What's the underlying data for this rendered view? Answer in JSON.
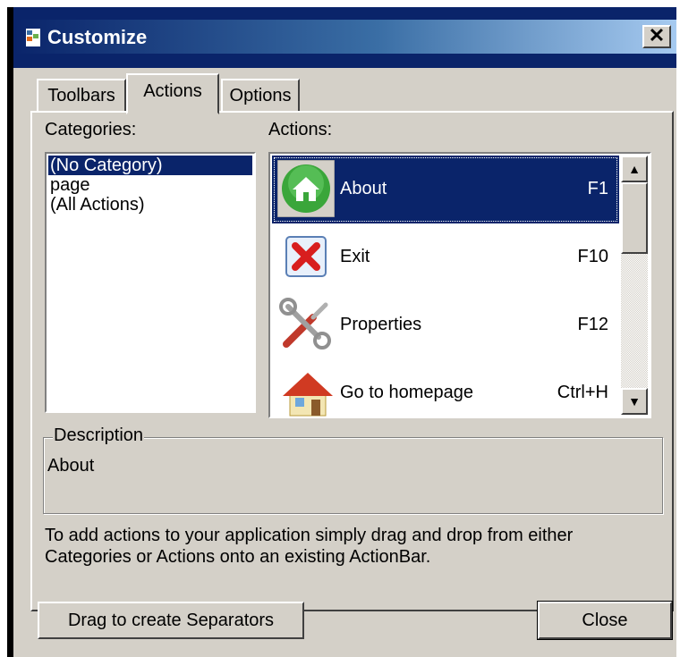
{
  "window": {
    "title": "Customize",
    "close_glyph": "✕"
  },
  "tabs": [
    {
      "label": "Toolbars",
      "active": false
    },
    {
      "label": "Actions",
      "active": true
    },
    {
      "label": "Options",
      "active": false
    }
  ],
  "categories": {
    "label": "Categories:",
    "items": [
      "(No Category)",
      "page",
      "(All Actions)"
    ],
    "selected": "(No Category)"
  },
  "actions": {
    "label": "Actions:",
    "items": [
      {
        "label": "About",
        "shortcut": "F1",
        "icon": "home-round-icon"
      },
      {
        "label": "Exit",
        "shortcut": "F10",
        "icon": "exit-x-icon"
      },
      {
        "label": "Properties",
        "shortcut": "F12",
        "icon": "tools-icon"
      },
      {
        "label": "Go to homepage",
        "shortcut": "Ctrl+H",
        "icon": "house-icon"
      }
    ],
    "selected": "About"
  },
  "description": {
    "label": "Description",
    "text": "About"
  },
  "hint_line1": "To add actions to your application simply drag and drop from either",
  "hint_line2": "Categories or Actions onto an existing ActionBar.",
  "buttons": {
    "separators": "Drag to create Separators",
    "close": "Close"
  },
  "colors": {
    "title_bar": "#0a246a",
    "face": "#d4d0c8",
    "selection": "#0a246a"
  }
}
